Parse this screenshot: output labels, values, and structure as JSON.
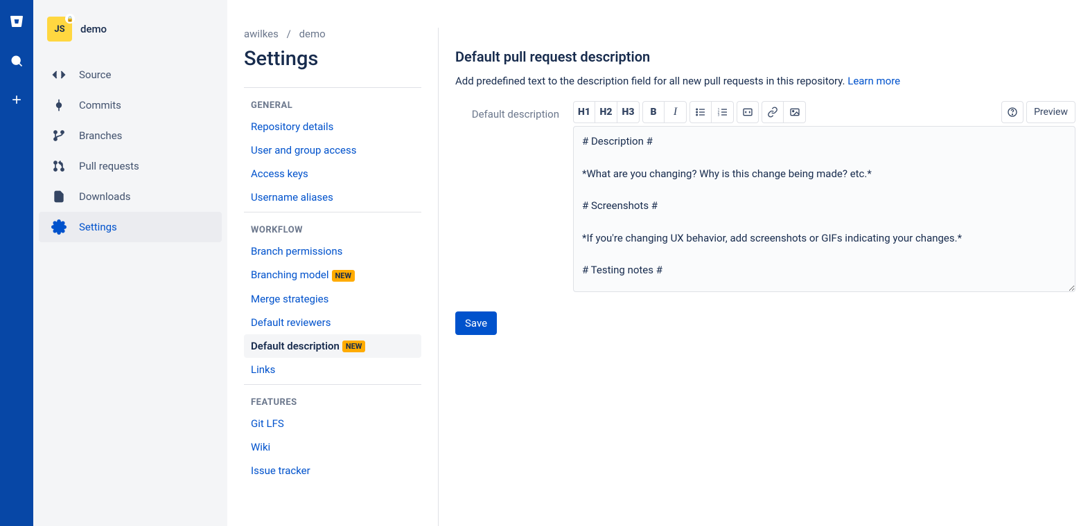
{
  "globalNav": {
    "icons": [
      "bitbucket",
      "search",
      "plus"
    ]
  },
  "repo": {
    "iconText": "JS",
    "name": "demo"
  },
  "sidebar": [
    {
      "id": "source",
      "icon": "code",
      "label": "Source"
    },
    {
      "id": "commits",
      "icon": "commit",
      "label": "Commits"
    },
    {
      "id": "branches",
      "icon": "branch",
      "label": "Branches"
    },
    {
      "id": "pullrequests",
      "icon": "pr",
      "label": "Pull requests"
    },
    {
      "id": "downloads",
      "icon": "download",
      "label": "Downloads"
    },
    {
      "id": "settings",
      "icon": "gear",
      "label": "Settings",
      "active": true
    }
  ],
  "breadcrumb": {
    "owner": "awilkes",
    "repo": "demo"
  },
  "pageTitle": "Settings",
  "sections": {
    "general": {
      "header": "GENERAL",
      "items": [
        "Repository details",
        "User and group access",
        "Access keys",
        "Username aliases"
      ]
    },
    "workflow": {
      "header": "WORKFLOW",
      "items": [
        {
          "label": "Branch permissions"
        },
        {
          "label": "Branching model",
          "badge": "NEW"
        },
        {
          "label": "Merge strategies"
        },
        {
          "label": "Default reviewers"
        },
        {
          "label": "Default description",
          "badge": "NEW",
          "selected": true
        },
        {
          "label": "Links"
        }
      ]
    },
    "features": {
      "header": "FEATURES",
      "items": [
        "Git LFS",
        "Wiki",
        "Issue tracker"
      ]
    }
  },
  "main": {
    "heading": "Default pull request description",
    "descText": "Add predefined text to the description field for all new pull requests in this repository. ",
    "learnMore": "Learn more",
    "formLabel": "Default description",
    "editorText": "# Description #\n\n*What are you changing? Why is this change being made? etc.*\n\n# Screenshots #\n\n*If you're changing UX behavior, add screenshots or GIFs indicating your changes.*\n\n# Testing notes #",
    "previewLabel": "Preview",
    "saveLabel": "Save"
  },
  "badgeNewText": "NEW"
}
